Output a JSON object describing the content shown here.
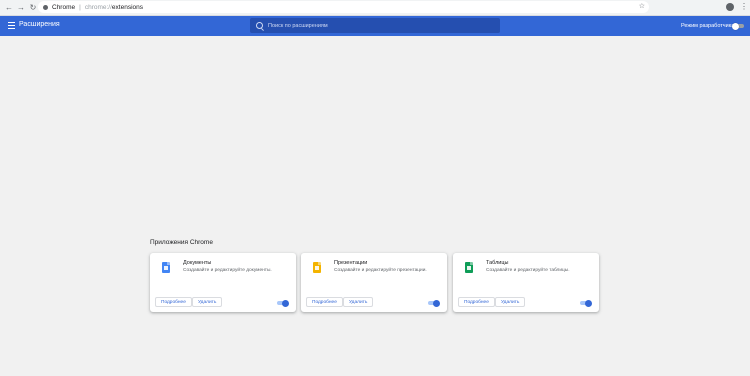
{
  "browser": {
    "site_label": "Chrome",
    "separator": "|",
    "url_scheme": "chrome://",
    "url_path": "extensions"
  },
  "header": {
    "title": "Расширения",
    "search_placeholder": "Поиск по расширениям",
    "dev_mode_label": "Режим разработчика",
    "dev_mode_on": false
  },
  "section_title": "Приложения Chrome",
  "apps": [
    {
      "name": "Документы",
      "description": "Создавайте и редактируйте документы.",
      "color": "#4285f4",
      "details_label": "Подробнее",
      "remove_label": "Удалить",
      "enabled": true
    },
    {
      "name": "Презентации",
      "description": "Создавайте и редактируйте презентации.",
      "color": "#f4b400",
      "details_label": "Подробнее",
      "remove_label": "Удалить",
      "enabled": true
    },
    {
      "name": "Таблицы",
      "description": "Создавайте и редактируйте таблицы.",
      "color": "#0f9d58",
      "details_label": "Подробнее",
      "remove_label": "Удалить",
      "enabled": true
    }
  ],
  "colors": {
    "header": "#3367d6",
    "accent": "#3367d6",
    "background": "#f1f1f1"
  }
}
